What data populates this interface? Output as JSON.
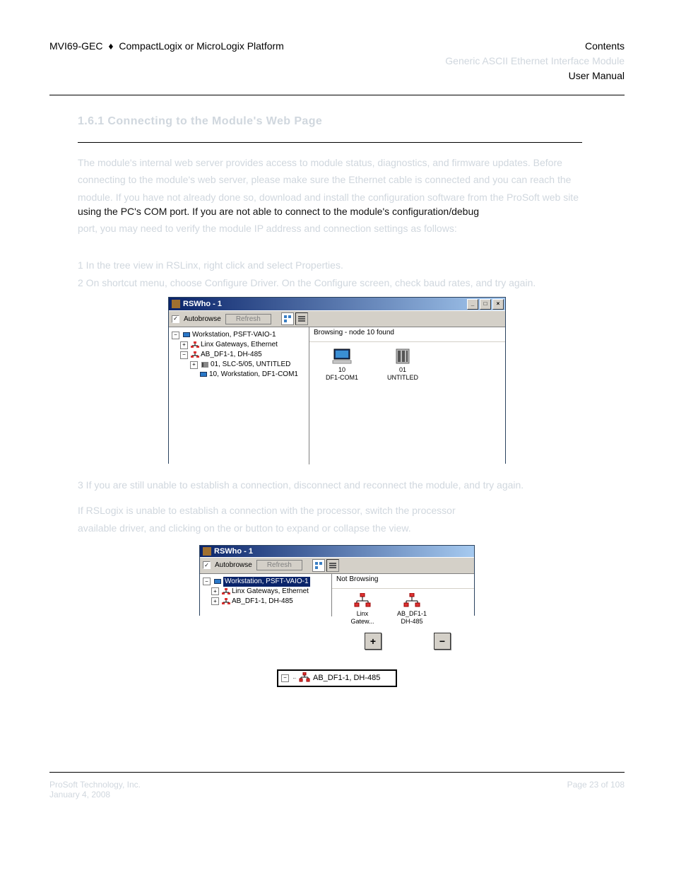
{
  "header": {
    "product": "MVI69-GEC",
    "diamond": "♦",
    "platform": "CompactLogix or MicroLogix Platform",
    "right_top": "Contents",
    "right_mid_faded": "Generic ASCII Ethernet Interface Module",
    "right_bottom": "User Manual"
  },
  "section": {
    "heading_faded": "1.6.1 Connecting to the Module's Web Page",
    "p1_line1_faded": "The module's internal web server provides access to module status, diagnostics, and firmware updates. Before",
    "p1_line2_faded": "connecting to the module's web server, please make sure the Ethernet cable is connected and you can reach the",
    "p1_line3_faded": "module. If you have not already done so, download and install the configuration software from the ProSoft web site",
    "p1_line4": "using the PC's COM port. If you are not able to connect to the module's configuration/debug",
    "p1_line5_faded": "port, you may need to verify the module IP address and connection settings as follows:"
  },
  "list1": {
    "item1_faded": "1  In the tree view in RSLinx, right click and select Properties.",
    "item2_faded": "2  On shortcut menu, choose Configure Driver. On the Configure screen, check baud rates, and try again."
  },
  "win1": {
    "title": "RSWho - 1",
    "autobrowse": "Autobrowse",
    "refresh": "Refresh",
    "status": "Browsing - node 10 found",
    "tree": {
      "root": "Workstation, PSFT-VAIO-1",
      "linx": "Linx Gateways, Ethernet",
      "driver": "AB_DF1-1, DH-485",
      "node01": "01, SLC-5/05, UNTITLED",
      "node10": "10, Workstation, DF1-COM1"
    },
    "gallery": {
      "i1_line1": "10",
      "i1_line2": "DF1-COM1",
      "i2_line1": "01",
      "i2_line2": "UNTITLED"
    }
  },
  "between": {
    "p_faded_1": "3  If you are still unable to establish a connection, disconnect and reconnect the module, and try again.",
    "p_faded_2": "If RSLogix is unable to establish a connection with the processor, switch the processor",
    "p_faded_3": "available driver, and clicking on the  or  button to expand or collapse the view."
  },
  "win2": {
    "title": "RSWho - 1",
    "autobrowse": "Autobrowse",
    "refresh": "Refresh",
    "status": "Not Browsing",
    "tree": {
      "root": "Workstation, PSFT-VAIO-1",
      "linx": "Linx Gateways, Ethernet",
      "driver": "AB_DF1-1, DH-485"
    },
    "gallery": {
      "i1_line1": "Linx",
      "i1_line2": "Gatew...",
      "i2_line1": "AB_DF1-1",
      "i2_line2": "DH-485"
    }
  },
  "expcol": {
    "plus": "+",
    "minus": "−"
  },
  "snippet": {
    "box": "−",
    "text": "AB_DF1-1, DH-485"
  },
  "footer": {
    "left1": "ProSoft Technology, Inc.",
    "left2": "January 4, 2008",
    "right": "Page 23 of 108"
  }
}
